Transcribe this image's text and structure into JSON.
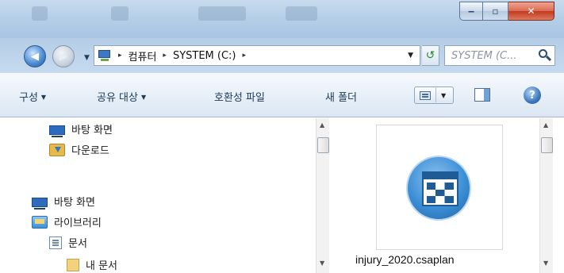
{
  "window": {
    "minimize_glyph": "‒",
    "maximize_glyph": "▫",
    "close_glyph": "✕"
  },
  "address": {
    "breadcrumbs": [
      "컴퓨터",
      "SYSTEM (C:)"
    ],
    "separator": "▸"
  },
  "search": {
    "placeholder": "SYSTEM (C..."
  },
  "toolbar": {
    "organize_label": "구성",
    "share_label": "공유 대상",
    "compat_label": "호환성 파일",
    "new_folder_label": "새 폴더",
    "help_glyph": "?"
  },
  "nav_tree": {
    "items": [
      {
        "label": "바탕 화면",
        "icon": "desktop-icon"
      },
      {
        "label": "다운로드",
        "icon": "downloads-folder-icon"
      },
      {
        "label": "바탕 화면",
        "icon": "desktop-icon"
      },
      {
        "label": "라이브러리",
        "icon": "library-icon"
      },
      {
        "label": "문서",
        "icon": "documents-icon"
      },
      {
        "label": "내 문서",
        "icon": "my-documents-icon"
      }
    ]
  },
  "content": {
    "files": [
      {
        "name": "injury_2020.csaplan",
        "icon": "csaplan-file-icon"
      }
    ]
  },
  "colors": {
    "titlebar": "#b6cfe8",
    "toolbar_text": "#1e3953",
    "close_button": "#c3391f"
  }
}
